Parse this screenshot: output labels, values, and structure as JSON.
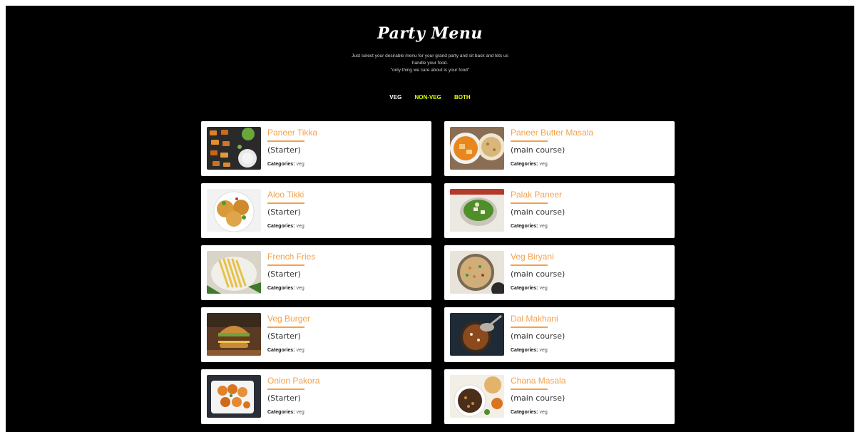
{
  "header": {
    "title": "Party Menu",
    "subtitle_lines": [
      "Just select your desirable menu for your grand party and sit back and lets us",
      "handle your food.",
      "\"only thing we care about is your food\""
    ]
  },
  "filters": [
    {
      "label": "VEG",
      "color": "#ffffff"
    },
    {
      "label": "NON-VEG",
      "color": "#d4ff00"
    },
    {
      "label": "BOTH",
      "color": "#e6ff00"
    }
  ],
  "categories_label": "Categories:",
  "items": [
    {
      "name": "Paneer Tikka",
      "course": "(Starter)",
      "category": "veg",
      "image": "paneer-tikka-image"
    },
    {
      "name": "Paneer Butter Masala",
      "course": "(main course)",
      "category": "veg",
      "image": "paneer-butter-masala-image"
    },
    {
      "name": "Aloo Tikki",
      "course": "(Starter)",
      "category": "veg",
      "image": "aloo-tikki-image"
    },
    {
      "name": "Palak Paneer",
      "course": "(main course)",
      "category": "veg",
      "image": "palak-paneer-image"
    },
    {
      "name": "French Fries",
      "course": "(Starter)",
      "category": "veg",
      "image": "french-fries-image"
    },
    {
      "name": "Veg Biryani",
      "course": "(main course)",
      "category": "veg",
      "image": "veg-biryani-image"
    },
    {
      "name": "Veg Burger",
      "course": "(Starter)",
      "category": "veg",
      "image": "veg-burger-image"
    },
    {
      "name": "Dal Makhani",
      "course": "(main course)",
      "category": "veg",
      "image": "dal-makhani-image"
    },
    {
      "name": "Onion Pakora",
      "course": "(Starter)",
      "category": "veg",
      "image": "onion-pakora-image"
    },
    {
      "name": "Chana Masala",
      "course": "(main course)",
      "category": "veg",
      "image": "chana-masala-image"
    }
  ],
  "colors": {
    "background": "#000000",
    "card": "#ffffff",
    "dish_name": "#f4a14b"
  }
}
